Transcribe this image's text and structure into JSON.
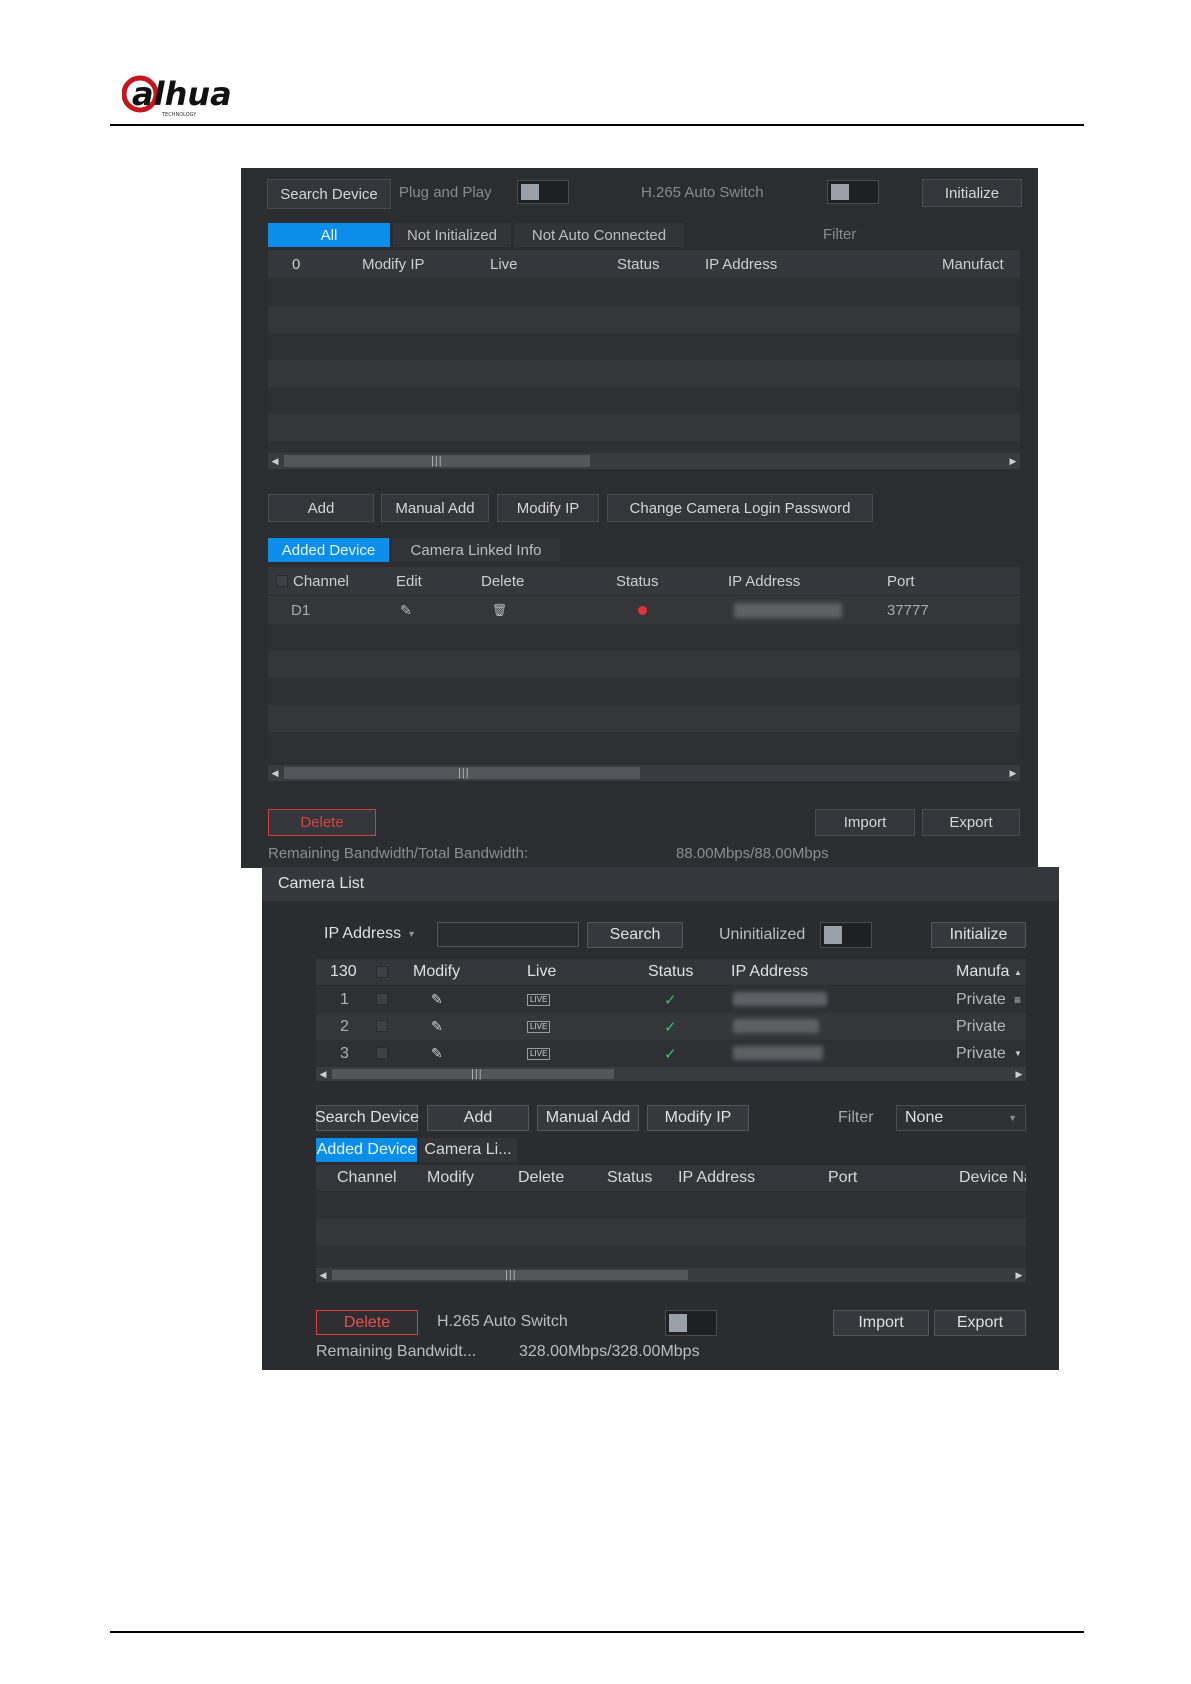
{
  "logo": {
    "text": "alhua",
    "tagline": "TECHNOLOGY"
  },
  "panel1": {
    "search_device": "Search Device",
    "plug_and_play": "Plug and Play",
    "h265_auto_switch": "H.265 Auto Switch",
    "initialize": "Initialize",
    "tabs": [
      "All",
      "Not Initialized",
      "Not Auto Connected"
    ],
    "filter_label": "Filter",
    "top_table": {
      "count": "0",
      "columns": [
        "Modify IP",
        "Live",
        "Status",
        "IP Address",
        "Manufact"
      ]
    },
    "actions": [
      "Add",
      "Manual Add",
      "Modify IP",
      "Change Camera Login Password"
    ],
    "lower_tabs": [
      "Added Device",
      "Camera Linked Info"
    ],
    "added_table": {
      "columns": [
        "Channel",
        "Edit",
        "Delete",
        "Status",
        "IP Address",
        "Port"
      ],
      "rows": [
        {
          "channel": "D1",
          "port": "37777"
        }
      ]
    },
    "delete": "Delete",
    "import": "Import",
    "export": "Export",
    "bandwidth_label": "Remaining Bandwidth/Total Bandwidth:",
    "bandwidth_value": "88.00Mbps/88.00Mbps",
    "status_color": "#e5323a",
    "accent": "#0a8ee9"
  },
  "panel2": {
    "title": "Camera List",
    "search_by": "IP Address",
    "search_button": "Search",
    "uninitialized": "Uninitialized",
    "initialize": "Initialize",
    "top_table": {
      "count": "130",
      "columns": [
        "Modify",
        "Live",
        "Status",
        "IP Address",
        "Manufa"
      ],
      "rows": [
        {
          "index": "1",
          "live": "LIVE",
          "manufacturer": "Private"
        },
        {
          "index": "2",
          "live": "LIVE",
          "manufacturer": "Private"
        },
        {
          "index": "3",
          "live": "LIVE",
          "manufacturer": "Private"
        }
      ]
    },
    "actions": [
      "Search Device",
      "Add",
      "Manual Add",
      "Modify IP"
    ],
    "filter_label": "Filter",
    "filter_value": "None",
    "lower_tabs": [
      "Added Device",
      "Camera Li..."
    ],
    "added_table": {
      "columns": [
        "Channel",
        "Modify",
        "Delete",
        "Status",
        "IP Address",
        "Port",
        "Device Na"
      ]
    },
    "delete": "Delete",
    "h265_auto_switch": "H.265 Auto Switch",
    "import": "Import",
    "export": "Export",
    "bandwidth_label": "Remaining Bandwidt...",
    "bandwidth_value": "328.00Mbps/328.00Mbps",
    "ok_color": "#33c46b",
    "accent": "#0a8ee9"
  }
}
